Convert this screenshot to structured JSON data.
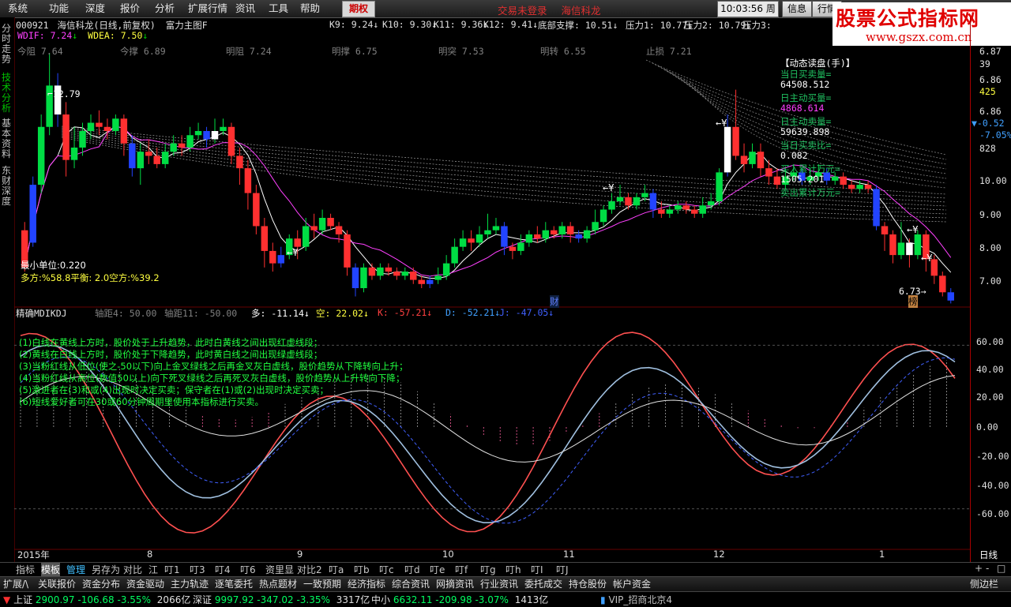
{
  "menu": {
    "items": [
      "系统",
      "功能",
      "深度",
      "报价",
      "分析",
      "扩展行情",
      "资讯",
      "工具",
      "帮助"
    ],
    "options_tab": "期权",
    "trade_status": "交易未登录",
    "trade_broker": "海信科龙",
    "clock": "10:03:56",
    "weekday": "周日",
    "info_btn": "信息",
    "quote_btn": "行情"
  },
  "watermark": {
    "line1": "股票公式指标网",
    "line2": "www.gszx.com.cn"
  },
  "sidebar": {
    "tabs": [
      "分时走势",
      "技术分析",
      "基本资料",
      "东财深度"
    ]
  },
  "header": {
    "code": "000921",
    "name": "海信科龙(日线,前复权)",
    "indicator": "富力主图F",
    "values": [
      {
        "label": "K9:",
        "value": "9.24↓"
      },
      {
        "label": "K10:",
        "value": "9.30↓"
      },
      {
        "label": "K11:",
        "value": "9.36↓"
      },
      {
        "label": "K12:",
        "value": "9.41↓"
      },
      {
        "label": "底部支撑:",
        "value": "10.51↓"
      },
      {
        "label": "压力1:",
        "value": "10.77↓"
      },
      {
        "label": "压力2:",
        "value": "10.79↓"
      },
      {
        "label": "压力3:",
        "value": ""
      }
    ]
  },
  "line2": [
    {
      "label": "WDIF:",
      "value": "7.24",
      "arrow": "↓"
    },
    {
      "label": "WDEA:",
      "value": "7.50",
      "arrow": "↓"
    }
  ],
  "line3": [
    {
      "label": "今阻",
      "value": "7.64"
    },
    {
      "label": "今撑",
      "value": "6.89"
    },
    {
      "label": "明阻",
      "value": "7.24"
    },
    {
      "label": "明撑",
      "value": "6.75"
    },
    {
      "label": "明突",
      "value": "7.53"
    },
    {
      "label": "明转",
      "value": "6.55"
    },
    {
      "label": "止损",
      "value": "7.21"
    }
  ],
  "price_labels": {
    "high": "12.79",
    "low": "6.73",
    "min_unit": "最小单位:0.220",
    "ratio": "多方:%58.8平衡: 2.0空方:%39.2",
    "cai": "财",
    "bang": "榜",
    "yen": "¥"
  },
  "dynamic": {
    "title": "【动态读盘(手)】",
    "rows": [
      {
        "label": "当日买卖量=",
        "value": "64508.512"
      },
      {
        "label": "日主动买量=",
        "value": "4868.614"
      },
      {
        "label": "日主动卖量=",
        "value": "59639.898"
      },
      {
        "label": "当日买卖比=",
        "value": "0.082"
      },
      {
        "label": "买入累计万元=",
        "value": "1505.201"
      },
      {
        "label": "卖出累计万元=",
        "value": ""
      }
    ]
  },
  "price_axis": {
    "ticks": [
      "6.87",
      "39",
      "6.86",
      "425",
      "6.86",
      "-0.52",
      "-7.05%",
      "828",
      "10.00",
      "9.00",
      "8.00",
      "7.00"
    ],
    "lower": [
      "60.00",
      "40.00",
      "20.00",
      "0.00",
      "-20.00",
      "-40.00",
      "-60.00"
    ]
  },
  "lower_header": {
    "name": "精确MDIKDJ",
    "items": [
      {
        "label": "轴距4:",
        "value": "50.00"
      },
      {
        "label": "轴距11:",
        "value": "-50.00"
      },
      {
        "label": "多:",
        "value": "-11.14↓"
      },
      {
        "label": "空:",
        "value": "22.02↓"
      },
      {
        "label": "K:",
        "value": "-57.21↓"
      },
      {
        "label": "D:",
        "value": "-52.21↓"
      },
      {
        "label": "J:",
        "value": "-47.05↓"
      }
    ]
  },
  "notes": [
    "(1)白线在黄线上方时，股价处于上升趋势，此时白黄线之间出现红虚线段；",
    "(2)黄线在白线上方时，股价处于下降趋势，此时黄白线之间出现绿虚线段；",
    "(3)当粉红线从低位(使之-50以下)向上金叉绿线之后再金叉灰白虚线，股价趋势从下降转向上升；",
    "(4)当粉红线从高位(数值50以上)向下死叉绿线之后再死叉灰白虚线，股价趋势从上升转向下降；",
    "(5)激进者在(3)和或(4)出现时决定买卖；保守者在(1)或(2)出现时决定买卖；",
    "(6)短线爱好者可在30或60分钟周期里使用本指标进行买卖。"
  ],
  "time_axis": {
    "labels": [
      "2015年",
      "8",
      "9",
      "10",
      "11",
      "12",
      "1"
    ],
    "period": "日线"
  },
  "zoom": {
    "plus": "+",
    "minus": "-",
    "square": "□"
  },
  "bottom_tabs": [
    "指标",
    "模板",
    "管理",
    "另存为",
    "对比",
    "江",
    "叮1",
    "叮3",
    "叮4",
    "叮6",
    "资里显",
    "对比2",
    "叮a",
    "叮b",
    "叮c",
    "叮d",
    "叮e",
    "叮f",
    "叮g",
    "叮h",
    "叮I",
    "叮J"
  ],
  "func_bar": [
    "扩展/\\",
    "关联报价",
    "资金分布",
    "资金驱动",
    "主力轨迹",
    "逐笔委托",
    "热点题材",
    "一致预期",
    "经济指标",
    "综合资讯",
    "网摘资讯",
    "行业资讯",
    "委托成交",
    "持仓股份",
    "帐户资金",
    "侧边栏"
  ],
  "status": {
    "sh_label": "上证",
    "sh_val": "2900.97",
    "sh_chg": "-106.68",
    "sh_pct": "-3.55%",
    "sh_amt": "2066亿",
    "sz_label": "深证",
    "sz_val": "9997.92",
    "sz_chg": "-347.02",
    "sz_pct": "-3.35%",
    "sz_amt": "3317亿",
    "zx_label": "中小",
    "zx_val": "6632.11",
    "zx_chg": "-209.98",
    "zx_pct": "-3.07%",
    "zx_amt": "1413亿",
    "vip": "VIP_招商北京4"
  },
  "colors": {
    "up": "#ff3030",
    "down": "#00dd44",
    "blue": "#2244ff",
    "white": "#ffffff",
    "bg": "#000000",
    "grid": "#660000",
    "axis_red": "#aa0000"
  },
  "chart_data": {
    "type": "candlestick",
    "ylim": [
      6.7,
      13.0
    ],
    "candles": [
      [
        8.5,
        7.6,
        8.7,
        7.5
      ],
      [
        8.2,
        9.6,
        9.8,
        8.1
      ],
      [
        9.6,
        11.0,
        11.3,
        9.4
      ],
      [
        11.0,
        12.0,
        12.79,
        10.8
      ],
      [
        12.0,
        11.3,
        12.3,
        11.0
      ],
      [
        11.3,
        10.2,
        11.6,
        9.8
      ],
      [
        10.2,
        10.5,
        11.0,
        10.0
      ],
      [
        10.5,
        10.9,
        11.1,
        10.3
      ],
      [
        10.9,
        11.1,
        11.3,
        10.7
      ],
      [
        11.1,
        11.0,
        11.4,
        10.8
      ],
      [
        11.0,
        10.9,
        11.2,
        10.7
      ],
      [
        10.9,
        11.2,
        11.3,
        10.8
      ],
      [
        11.2,
        10.6,
        11.3,
        10.3
      ],
      [
        10.6,
        10.0,
        10.8,
        9.8
      ],
      [
        10.0,
        10.4,
        10.6,
        9.6
      ],
      [
        10.4,
        10.3,
        10.7,
        10.1
      ],
      [
        10.3,
        10.1,
        10.5,
        10.0
      ],
      [
        10.1,
        10.4,
        10.6,
        10.0
      ],
      [
        10.4,
        10.6,
        10.8,
        10.3
      ],
      [
        10.6,
        10.5,
        10.8,
        10.3
      ],
      [
        10.5,
        10.8,
        11.0,
        10.4
      ],
      [
        10.8,
        10.9,
        11.1,
        10.7
      ],
      [
        10.9,
        10.7,
        11.0,
        10.5
      ],
      [
        10.7,
        10.9,
        11.2,
        10.6
      ],
      [
        10.9,
        11.0,
        11.2,
        10.8
      ],
      [
        11.0,
        10.3,
        11.1,
        10.1
      ],
      [
        10.3,
        10.0,
        10.5,
        9.6
      ],
      [
        10.0,
        9.4,
        10.2,
        9.0
      ],
      [
        9.4,
        8.6,
        9.6,
        8.4
      ],
      [
        8.6,
        8.0,
        8.8,
        7.6
      ],
      [
        8.0,
        7.7,
        8.2,
        7.5
      ],
      [
        7.7,
        7.9,
        8.1,
        7.6
      ],
      [
        7.9,
        8.3,
        8.4,
        7.8
      ],
      [
        8.3,
        8.1,
        8.5,
        7.8
      ],
      [
        8.1,
        8.6,
        8.8,
        8.0
      ],
      [
        8.6,
        8.5,
        8.9,
        8.3
      ],
      [
        8.5,
        8.8,
        9.0,
        8.4
      ],
      [
        8.8,
        8.6,
        8.9,
        8.5
      ],
      [
        8.6,
        8.4,
        8.7,
        8.2
      ],
      [
        8.4,
        7.6,
        8.5,
        7.4
      ],
      [
        7.6,
        7.1,
        7.7,
        6.9
      ],
      [
        7.1,
        7.6,
        7.7,
        7.0
      ],
      [
        7.6,
        7.4,
        7.7,
        7.3
      ],
      [
        7.4,
        7.6,
        7.7,
        7.3
      ],
      [
        7.6,
        7.5,
        7.7,
        7.4
      ],
      [
        7.5,
        7.4,
        7.6,
        7.3
      ],
      [
        7.4,
        7.5,
        7.6,
        7.3
      ],
      [
        7.5,
        7.3,
        7.6,
        7.2
      ],
      [
        7.3,
        7.2,
        7.4,
        7.1
      ],
      [
        7.2,
        7.3,
        7.4,
        7.1
      ],
      [
        7.3,
        7.4,
        7.6,
        7.2
      ],
      [
        7.4,
        7.7,
        7.9,
        7.3
      ],
      [
        7.7,
        8.1,
        8.3,
        7.6
      ],
      [
        8.1,
        8.3,
        8.5,
        8.0
      ],
      [
        8.3,
        8.2,
        8.5,
        8.0
      ],
      [
        8.2,
        8.4,
        8.6,
        8.1
      ],
      [
        8.4,
        8.5,
        8.9,
        8.3
      ],
      [
        8.5,
        8.6,
        8.8,
        8.4
      ],
      [
        8.6,
        8.1,
        8.7,
        7.9
      ],
      [
        8.1,
        8.0,
        8.2,
        7.8
      ],
      [
        8.0,
        8.2,
        8.4,
        7.9
      ],
      [
        8.2,
        8.4,
        8.5,
        8.1
      ],
      [
        8.4,
        8.3,
        8.6,
        8.2
      ],
      [
        8.3,
        8.5,
        8.7,
        8.2
      ],
      [
        8.5,
        8.4,
        8.6,
        8.3
      ],
      [
        8.4,
        8.6,
        8.7,
        8.3
      ],
      [
        8.6,
        8.4,
        8.7,
        8.2
      ],
      [
        8.4,
        8.3,
        8.5,
        8.2
      ],
      [
        8.3,
        8.5,
        8.6,
        8.2
      ],
      [
        8.5,
        8.7,
        9.0,
        8.4
      ],
      [
        8.7,
        9.0,
        9.1,
        8.6
      ],
      [
        9.0,
        9.2,
        9.4,
        8.9
      ],
      [
        9.2,
        9.3,
        9.6,
        9.1
      ],
      [
        9.3,
        9.1,
        9.4,
        9.0
      ],
      [
        9.1,
        9.3,
        9.4,
        9.0
      ],
      [
        9.3,
        9.4,
        9.6,
        9.2
      ],
      [
        9.4,
        9.0,
        9.5,
        8.8
      ],
      [
        9.0,
        8.9,
        9.2,
        8.8
      ],
      [
        8.9,
        9.0,
        9.1,
        8.8
      ],
      [
        9.0,
        9.1,
        9.2,
        8.9
      ],
      [
        9.1,
        9.0,
        9.2,
        8.9
      ],
      [
        9.0,
        8.9,
        9.1,
        8.8
      ],
      [
        8.9,
        9.1,
        9.3,
        8.8
      ],
      [
        9.1,
        9.2,
        9.4,
        9.0
      ],
      [
        9.2,
        9.9,
        10.0,
        9.1
      ],
      [
        9.9,
        11.0,
        11.3,
        9.8
      ],
      [
        11.0,
        10.3,
        11.9,
        10.2
      ],
      [
        10.3,
        10.1,
        10.6,
        9.9
      ],
      [
        10.1,
        10.4,
        10.6,
        10.0
      ],
      [
        10.4,
        10.0,
        10.6,
        9.8
      ],
      [
        10.0,
        9.8,
        10.2,
        9.6
      ],
      [
        9.8,
        9.6,
        10.0,
        9.5
      ],
      [
        9.6,
        9.8,
        10.0,
        9.5
      ],
      [
        9.8,
        9.9,
        10.1,
        9.7
      ],
      [
        9.9,
        9.7,
        10.0,
        9.6
      ],
      [
        9.7,
        9.8,
        10.0,
        9.6
      ],
      [
        9.8,
        9.9,
        10.1,
        9.7
      ],
      [
        9.9,
        9.7,
        10.0,
        9.6
      ],
      [
        9.7,
        9.8,
        9.9,
        9.6
      ],
      [
        9.8,
        9.6,
        9.9,
        9.5
      ],
      [
        9.6,
        9.5,
        9.7,
        9.4
      ],
      [
        9.5,
        9.6,
        9.7,
        9.4
      ],
      [
        9.6,
        9.5,
        9.7,
        9.4
      ],
      [
        9.5,
        8.6,
        9.6,
        8.5
      ],
      [
        8.6,
        8.4,
        8.7,
        8.0
      ],
      [
        8.4,
        7.9,
        8.5,
        7.7
      ],
      [
        7.9,
        8.2,
        8.7,
        7.8
      ],
      [
        8.2,
        7.9,
        8.3,
        7.6
      ],
      [
        7.9,
        8.4,
        8.5,
        7.8
      ],
      [
        8.4,
        7.8,
        8.5,
        7.5
      ],
      [
        7.8,
        7.4,
        7.9,
        7.2
      ],
      [
        7.4,
        7.0,
        7.5,
        6.9
      ],
      [
        7.0,
        6.8,
        7.1,
        6.73
      ]
    ]
  }
}
